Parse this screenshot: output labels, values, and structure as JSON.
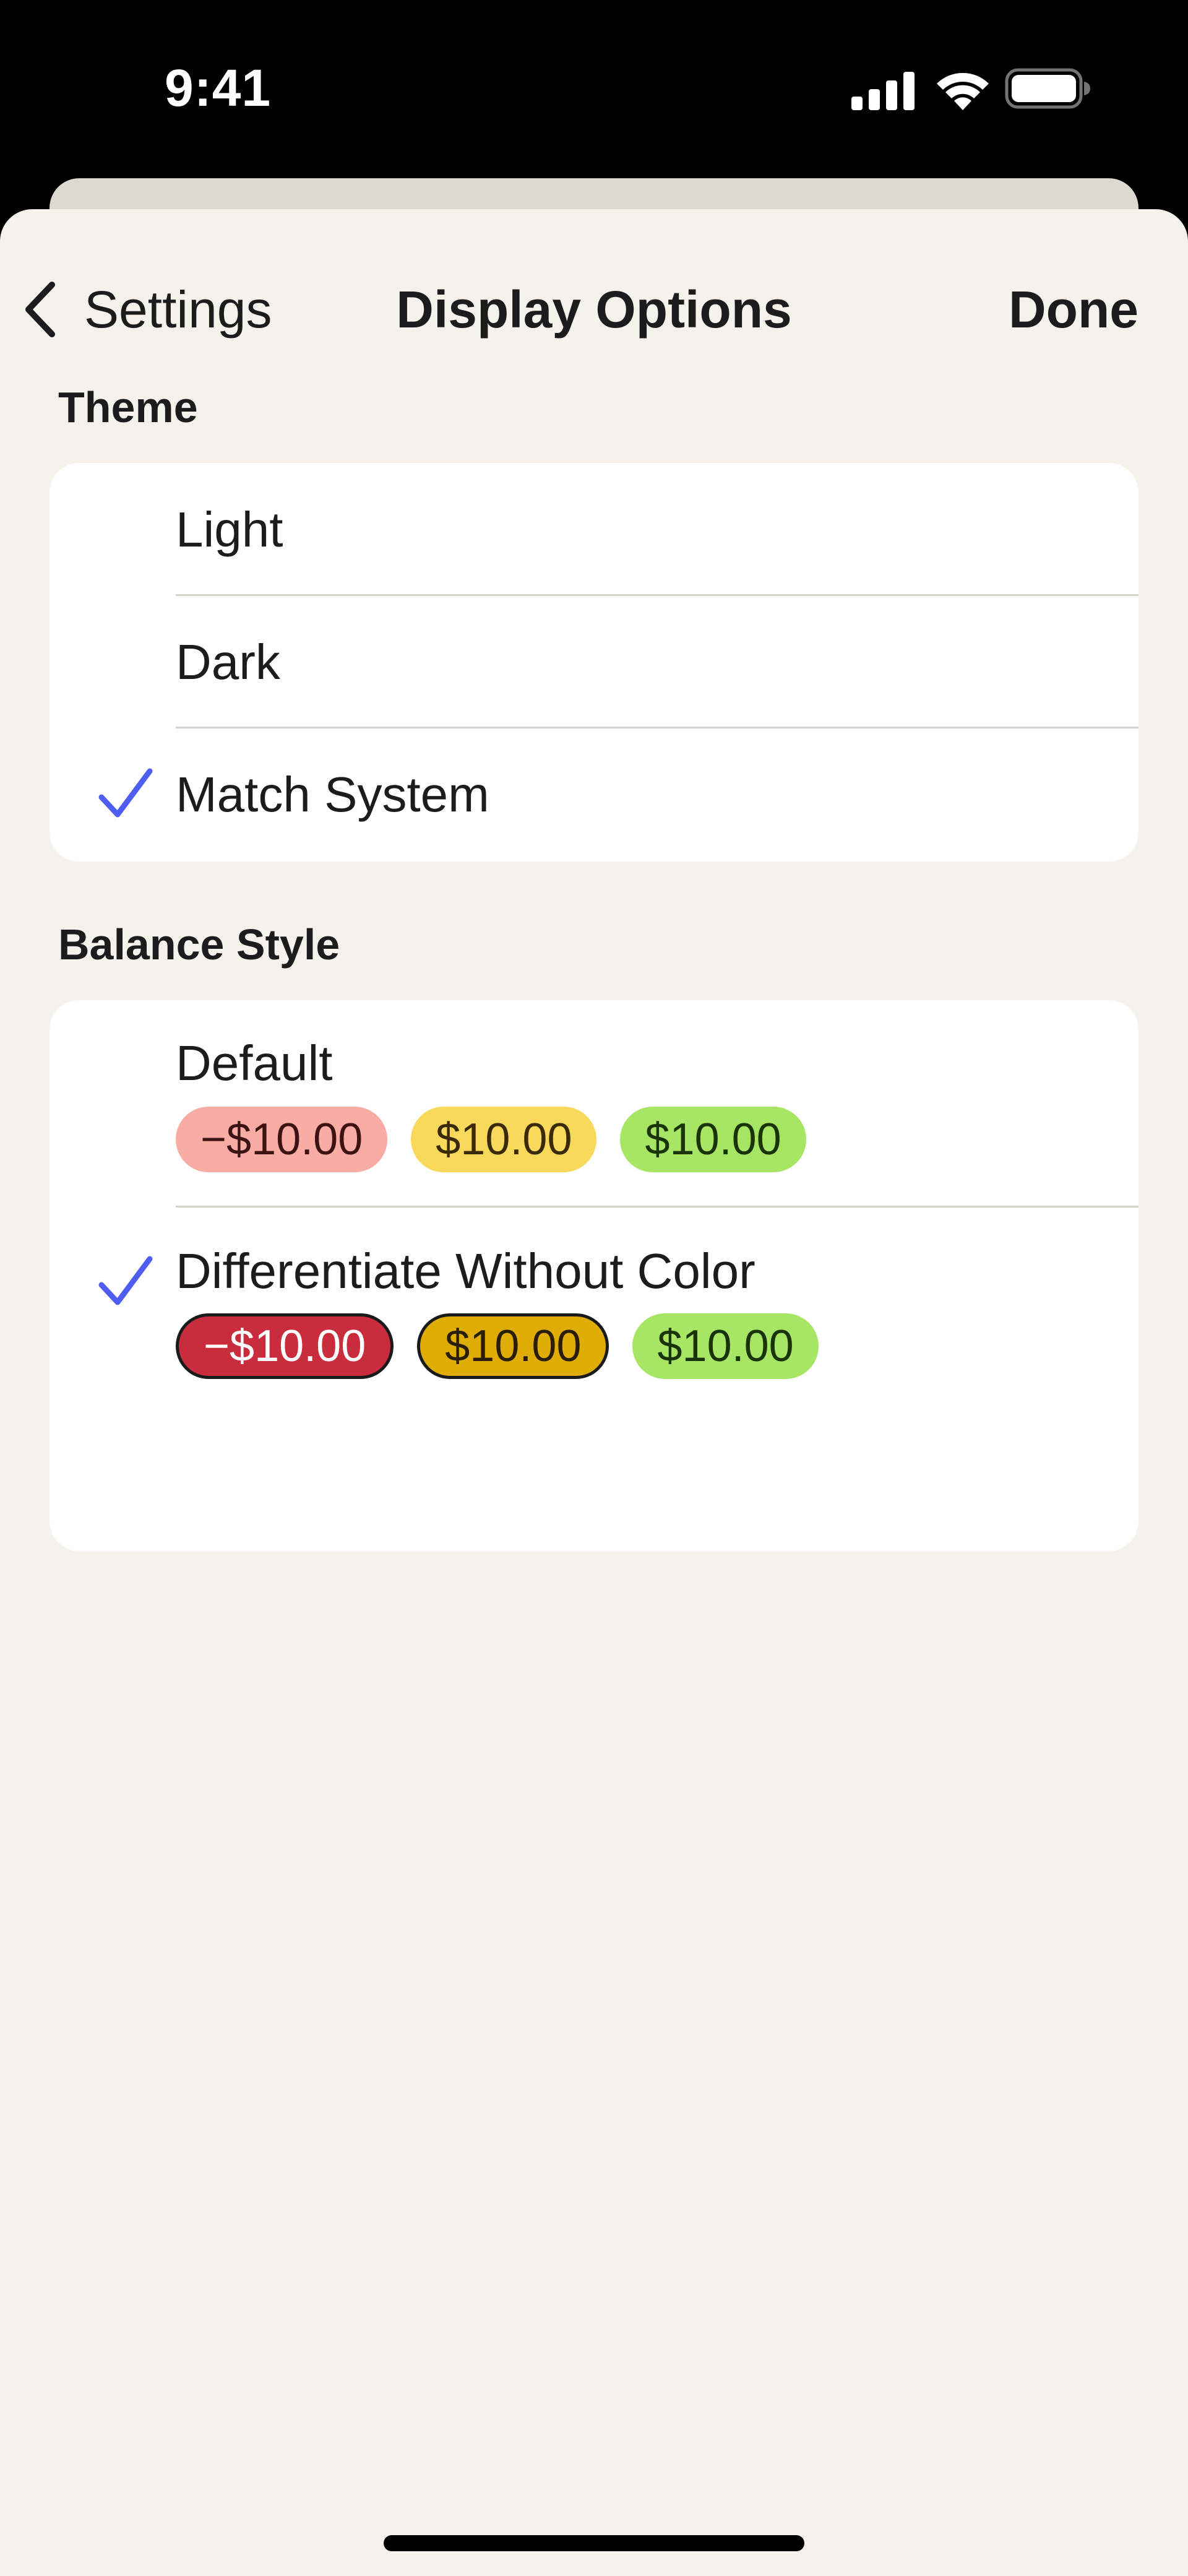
{
  "status_bar": {
    "time": "9:41",
    "icons": [
      "cellular-signal-icon",
      "wifi-icon",
      "battery-icon"
    ]
  },
  "nav": {
    "back_label": "Settings",
    "title": "Display Options",
    "done_label": "Done"
  },
  "theme": {
    "header": "Theme",
    "options": [
      {
        "label": "Light",
        "selected": false
      },
      {
        "label": "Dark",
        "selected": false
      },
      {
        "label": "Match System",
        "selected": true
      }
    ]
  },
  "balance_style": {
    "header": "Balance Style",
    "options": [
      {
        "label": "Default",
        "selected": false,
        "pills": [
          {
            "text": "−$10.00",
            "bg": "#f9aca4",
            "fg": "#3d1212"
          },
          {
            "text": "$10.00",
            "bg": "#f9d95c",
            "fg": "#3a2a08"
          },
          {
            "text": "$10.00",
            "bg": "#a7e565",
            "fg": "#1a3308"
          }
        ]
      },
      {
        "label": "Differentiate Without Color",
        "selected": true,
        "pills": [
          {
            "text": "−$10.00",
            "bg": "#c92c3c",
            "fg": "#ffffff"
          },
          {
            "text": "$10.00",
            "bg": "#e0ad06",
            "fg": "#2a1e00"
          },
          {
            "text": "$10.00",
            "bg": "#a7e565",
            "fg": "#1a3308"
          }
        ]
      }
    ]
  },
  "colors": {
    "accent": "#4f5df0",
    "background": "#f4f2eb",
    "card": "#ffffff"
  }
}
